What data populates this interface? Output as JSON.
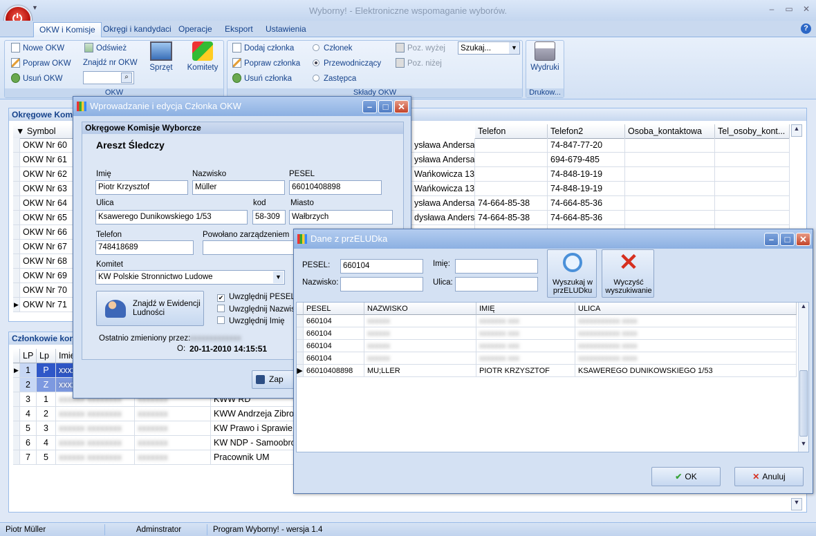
{
  "app": {
    "title": "Wyborny! - Elektroniczne wspomaganie wyborów."
  },
  "tabs": [
    "OKW i Komisje",
    "Okręgi i kandydaci",
    "Operacje",
    "Eksport",
    "Ustawienia"
  ],
  "ribbon": {
    "okw_group": {
      "label": "OKW",
      "new": "Nowe OKW",
      "edit": "Popraw OKW",
      "delete": "Usuń OKW",
      "refresh": "Odśwież",
      "find_label": "Znajdź nr OKW",
      "find_value": "",
      "equipment": "Sprzęt",
      "committees": "Komitety"
    },
    "members_group": {
      "label": "Składy OKW",
      "add": "Dodaj członka",
      "edit": "Popraw członka",
      "delete": "Usuń członka",
      "r_member": "Członek",
      "r_chair": "Przewodniczący",
      "r_deputy": "Zastępca",
      "selected_role": "Przewodniczący",
      "up": "Poz. wyżej",
      "down": "Poz. niżej",
      "search_select": "Szukaj..."
    },
    "print_group": {
      "label": "Drukow...",
      "print": "Wydruki"
    }
  },
  "okw_panel": {
    "title": "Okręgowe Komisje Wyborcze",
    "columns": [
      "Symbol",
      "Telefon",
      "Telefon2",
      "Osoba_kontaktowa",
      "Tel_osoby_kont..."
    ],
    "rows": [
      {
        "symbol": "OKW Nr 60",
        "addr": "ysława Andersa",
        "tel": "",
        "tel2": "74-847-77-20"
      },
      {
        "symbol": "OKW Nr 61",
        "addr": "ysława Andersa",
        "tel": "",
        "tel2": "694-679-485"
      },
      {
        "symbol": "OKW Nr 62",
        "addr": "Wańkowicza 13",
        "tel": "",
        "tel2": "74-848-19-19"
      },
      {
        "symbol": "OKW Nr 63",
        "addr": "Wańkowicza 13",
        "tel": "",
        "tel2": "74-848-19-19"
      },
      {
        "symbol": "OKW Nr 64",
        "addr": "ysława Andersa",
        "tel": "74-664-85-38",
        "tel2": "74-664-85-36"
      },
      {
        "symbol": "OKW Nr 65",
        "addr": "dysława Andersa",
        "tel": "74-664-85-38",
        "tel2": "74-664-85-36"
      },
      {
        "symbol": "OKW Nr 66",
        "addr": "",
        "tel": "",
        "tel2": ""
      },
      {
        "symbol": "OKW Nr 67",
        "addr": "",
        "tel": "",
        "tel2": ""
      },
      {
        "symbol": "OKW Nr 68",
        "addr": "",
        "tel": "",
        "tel2": ""
      },
      {
        "symbol": "OKW Nr 69",
        "addr": "",
        "tel": "",
        "tel2": ""
      },
      {
        "symbol": "OKW Nr 70",
        "addr": "",
        "tel": "",
        "tel2": ""
      },
      {
        "symbol": "OKW Nr 71",
        "addr": "",
        "tel": "",
        "tel2": ""
      }
    ]
  },
  "members_panel": {
    "title": "Członkowie kon",
    "columns": [
      "LP",
      "Lp",
      "Imie"
    ],
    "rows": [
      {
        "lp": "1",
        "lp2": "P",
        "committee": ""
      },
      {
        "lp": "2",
        "lp2": "Z",
        "committee": ""
      },
      {
        "lp": "3",
        "lp2": "1",
        "committee": "KWW RD"
      },
      {
        "lp": "4",
        "lp2": "2",
        "committee": "KWW Andrzeja Zibro"
      },
      {
        "lp": "5",
        "lp2": "3",
        "committee": "KW Prawo i Sprawie"
      },
      {
        "lp": "6",
        "lp2": "4",
        "committee": "KW NDP - Samoobro"
      },
      {
        "lp": "7",
        "lp2": "5",
        "committee": "Pracownik UM"
      }
    ]
  },
  "member_dialog": {
    "title": "Wprowadzanie i edycja Członka OKW",
    "section": "Okręgowe Komisje Wyborcze",
    "okw_name": "Areszt Śledczy",
    "labels": {
      "first": "Imię",
      "last": "Nazwisko",
      "pesel": "PESEL",
      "street": "Ulica",
      "code": "kod",
      "city": "Miasto",
      "phone": "Telefon",
      "appointed": "Powołano zarządzeniem",
      "committee": "Komitet"
    },
    "values": {
      "first": "Piotr Krzysztof",
      "last": "Müller",
      "pesel": "66010408898",
      "street": "Ksawerego Dunikowskiego 1/53",
      "code": "58-309",
      "city": "Wałbrzych",
      "phone": "748418689",
      "appointed": "",
      "committee": "KW Polskie Stronnictwo Ludowe"
    },
    "find_button": "Znajdź w Ewidencji Ludności",
    "check_pesel": "Uwzględnij PESEL",
    "check_surname": "Uwzględnij Nazwisk",
    "check_name": "Uwzględnij Imię",
    "last_changed_label": "Ostatnio zmieniony przez:",
    "on_label": "O:",
    "on_value": "20-11-2010 14:15:51",
    "save_button": "Zap"
  },
  "elud_dialog": {
    "title": "Dane z przELUDka",
    "pesel_label": "PESEL:",
    "pesel_value": "660104",
    "surname_label": "Nazwisko:",
    "surname_value": "",
    "name_label": "Imię:",
    "name_value": "",
    "street_label": "Ulica:",
    "street_value": "",
    "search_button": "Wyszukaj w przELUDku",
    "clear_button": "Wyczyść wyszukiwanie",
    "columns": [
      "PESEL",
      "NAZWISKO",
      "IMIĘ",
      "ULICA"
    ],
    "rows": [
      {
        "pesel": "660104",
        "surname": "",
        "name": "",
        "street": ""
      },
      {
        "pesel": "660104",
        "surname": "",
        "name": "",
        "street": ""
      },
      {
        "pesel": "660104",
        "surname": "",
        "name": "",
        "street": ""
      },
      {
        "pesel": "660104",
        "surname": "",
        "name": "",
        "street": ""
      },
      {
        "pesel": "66010408898",
        "surname": "MU;LLER",
        "name": "PIOTR KRZYSZTOF",
        "street": "KSAWEREGO DUNIKOWSKIEGO 1/53"
      }
    ],
    "ok": "OK",
    "cancel": "Anuluj"
  },
  "status": {
    "user": "Piotr Müller",
    "role": "Adminstrator",
    "program": "Program Wyborny! - wersja 1.4"
  }
}
